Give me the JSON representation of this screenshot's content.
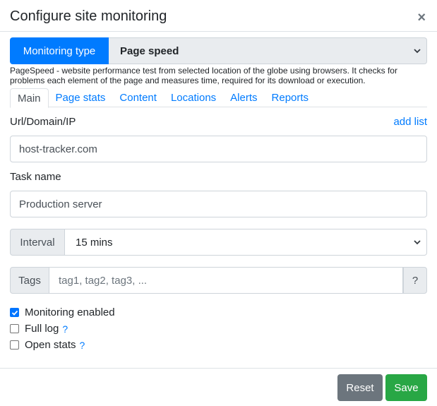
{
  "modal": {
    "title": "Configure site monitoring",
    "close_symbol": "×"
  },
  "monitoring_type": {
    "label": "Monitoring type",
    "selected": "Page speed",
    "description": "PageSpeed - website performance test from selected location of the globe using browsers. It checks for problems each element of the page and measures time, required for its download or execution."
  },
  "tabs": [
    {
      "label": "Main",
      "active": true
    },
    {
      "label": "Page stats",
      "active": false
    },
    {
      "label": "Content",
      "active": false
    },
    {
      "label": "Locations",
      "active": false
    },
    {
      "label": "Alerts",
      "active": false
    },
    {
      "label": "Reports",
      "active": false
    }
  ],
  "url_field": {
    "label": "Url/Domain/IP",
    "add_list_link": "add list",
    "value": "host-tracker.com"
  },
  "task_name": {
    "label": "Task name",
    "value": "Production server"
  },
  "interval": {
    "label": "Interval",
    "selected": "15 mins"
  },
  "tags": {
    "label": "Tags",
    "placeholder": "tag1, tag2, tag3, ...",
    "help": "?"
  },
  "options": {
    "monitoring_enabled": {
      "label": "Monitoring enabled",
      "checked": true
    },
    "full_log": {
      "label": "Full log",
      "checked": false,
      "help": "?"
    },
    "open_stats": {
      "label": "Open stats",
      "checked": false,
      "help": "?"
    }
  },
  "footer": {
    "reset_label": "Reset",
    "save_label": "Save"
  },
  "colors": {
    "primary": "#007bff",
    "secondary": "#6c757d",
    "success": "#28a745",
    "addon_bg": "#e9ecef"
  }
}
